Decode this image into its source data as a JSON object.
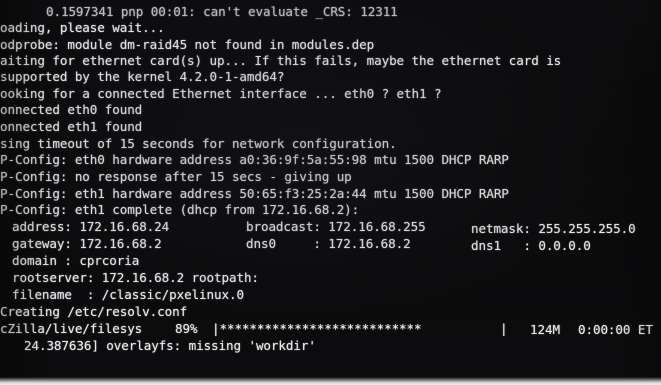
{
  "console": {
    "lines": [
      "0.1597341 pnp 00:01: can't evaluate _CRS: 12311",
      "oading, please wait...",
      "odprobe: module dm-raid45 not found in modules.dep",
      "aiting for ethernet card(s) up... If this fails, maybe the ethernet card is",
      "supported by the kernel 4.2.0-1-amd64?",
      "ooking for a connected Ethernet interface ... eth0 ? eth1 ?",
      "onnected eth0 found",
      "onnected eth1 found",
      "sing timeout of 15 seconds for network configuration.",
      "P-Config: eth0 hardware address a0:36:9f:5a:55:98 mtu 1500 DHCP RARP",
      "P-Config: no response after 15 secs - giving up",
      "P-Config: eth1 hardware address 50:65:f3:25:2a:44 mtu 1500 DHCP RARP",
      "P-Config: eth1 complete (dhcp from 172.16.68.2):"
    ],
    "net": {
      "address_label": "address: 172.16.68.24",
      "broadcast_label": "broadcast: 172.16.68.255",
      "netmask_label": "netmask: 255.255.255.0",
      "gateway_label": "gateway: 172.16.68.2",
      "dns0_label": "dns0     : 172.16.68.2",
      "dns1_label": "dns1   : 0.0.0.0",
      "domain_label": "domain : cprcoria",
      "rootserver_label": "rootserver: 172.16.68.2 rootpath:",
      "filename_label": "filename  : /classic/pxelinux.0"
    },
    "resolv": "Creating /etc/resolv.conf",
    "progress": {
      "path": "cZilla/live/filesys",
      "percent": "89%",
      "bar": "|***************************",
      "separator": "|",
      "size": "124M",
      "eta": "0:00:00 ET"
    },
    "overlay": "24.387636] overlayfs: missing 'workdir'"
  }
}
